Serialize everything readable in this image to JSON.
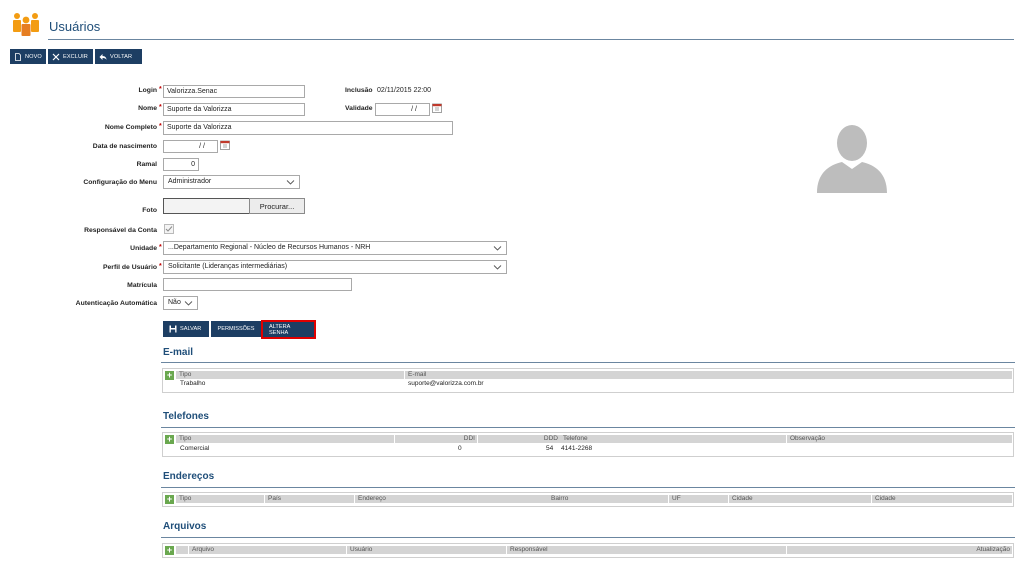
{
  "header": {
    "title": "Usuários"
  },
  "toolbar": {
    "novo": "NOVO",
    "excluir": "EXCLUIR",
    "voltar": "VOLTAR"
  },
  "form": {
    "login": {
      "label": "Login",
      "value": "Valorizza.Senac"
    },
    "inclusao": {
      "label": "Inclusão",
      "value": "02/11/2015 22:00"
    },
    "nome": {
      "label": "Nome",
      "value": "Suporte da Valorizza"
    },
    "validade": {
      "label": "Validade",
      "value": "/ /"
    },
    "nome_completo": {
      "label": "Nome Completo",
      "value": "Suporte da Valorizza"
    },
    "data_nascimento": {
      "label": "Data de nascimento",
      "value": "/ /"
    },
    "ramal": {
      "label": "Ramal",
      "value": "0"
    },
    "config_menu": {
      "label": "Configuração do Menu",
      "value": "Administrador"
    },
    "foto": {
      "label": "Foto",
      "button": "Procurar..."
    },
    "responsavel": {
      "label": "Responsável da Conta",
      "checked": true
    },
    "unidade": {
      "label": "Unidade",
      "value": "...Departamento Regional - Núcleo de Recursos Humanos - NRH"
    },
    "perfil": {
      "label": "Perfil de Usuário",
      "value": "Solicitante (Lideranças intermediárias)"
    },
    "matricula": {
      "label": "Matrícula",
      "value": ""
    },
    "autenticacao": {
      "label": "Autenticação Automática",
      "value": "Não"
    }
  },
  "actions": {
    "salvar": "SALVAR",
    "permissoes": "PERMISSÕES",
    "altera_senha": "ALTERA SENHA"
  },
  "email": {
    "title": "E-mail",
    "headers": [
      "Tipo",
      "E-mail"
    ],
    "rows": [
      {
        "tipo": "Trabalho",
        "email": "suporte@valorizza.com.br"
      }
    ]
  },
  "telefones": {
    "title": "Telefones",
    "headers": [
      "Tipo",
      "DDI",
      "DDD",
      "Telefone",
      "Observação"
    ],
    "rows": [
      {
        "tipo": "Comercial",
        "ddi": "0",
        "ddd": "54",
        "telefone": "4141-2268",
        "obs": ""
      }
    ]
  },
  "enderecos": {
    "title": "Endereços",
    "headers": [
      "Tipo",
      "País",
      "Endereço",
      "Bairro",
      "UF",
      "Cidade",
      "Cidade"
    ]
  },
  "arquivos": {
    "title": "Arquivos",
    "headers": [
      "Arquivo",
      "Usuário",
      "Responsável",
      "Atualização"
    ]
  },
  "colors": {
    "navy": "#1d3e63",
    "title": "#1f4e79",
    "accent": "#f39c12",
    "highlight": "#e00000"
  }
}
